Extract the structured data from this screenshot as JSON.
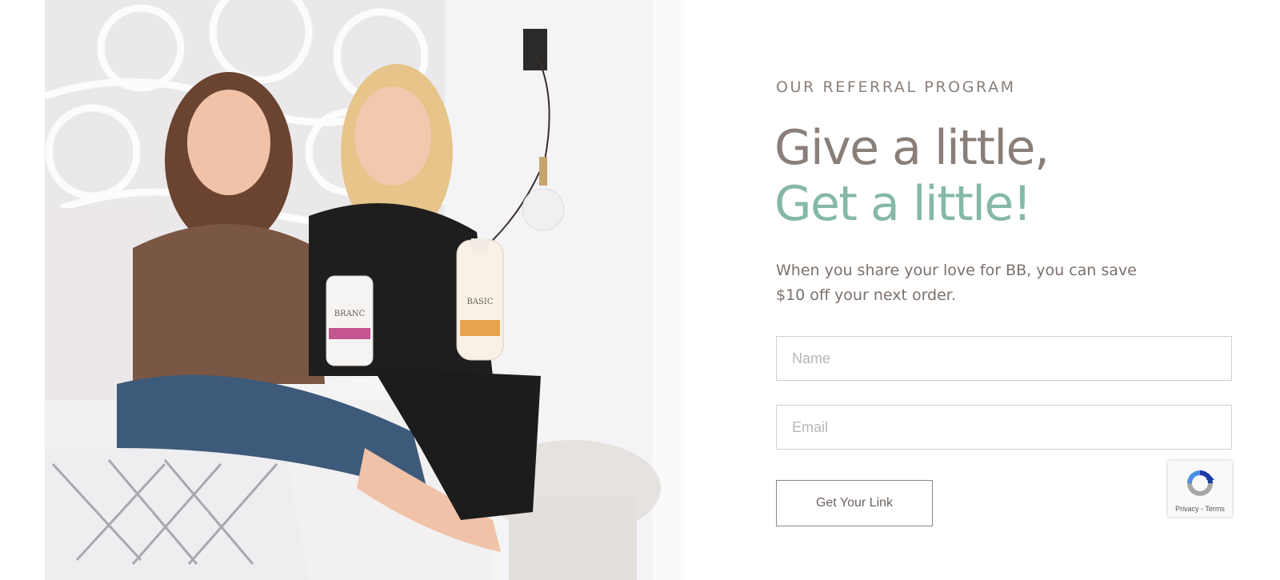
{
  "photo": {
    "alt": "Two women sitting on a bed holding Branch Basics products"
  },
  "referral": {
    "eyebrow": "OUR REFERRAL PROGRAM",
    "headline_line1": "Give a little,",
    "headline_line2": "Get a little!",
    "description": "When you share your love for BB, you can save $10 off your next order."
  },
  "form": {
    "name_placeholder": "Name",
    "email_placeholder": "Email",
    "submit_label": "Get Your Link"
  },
  "recaptcha": {
    "privacy_label": "Privacy",
    "separator": " - ",
    "terms_label": "Terms"
  },
  "colors": {
    "heading_taupe": "#8a7f78",
    "accent_teal": "#85b8a8",
    "field_border": "#d2cdcb"
  }
}
